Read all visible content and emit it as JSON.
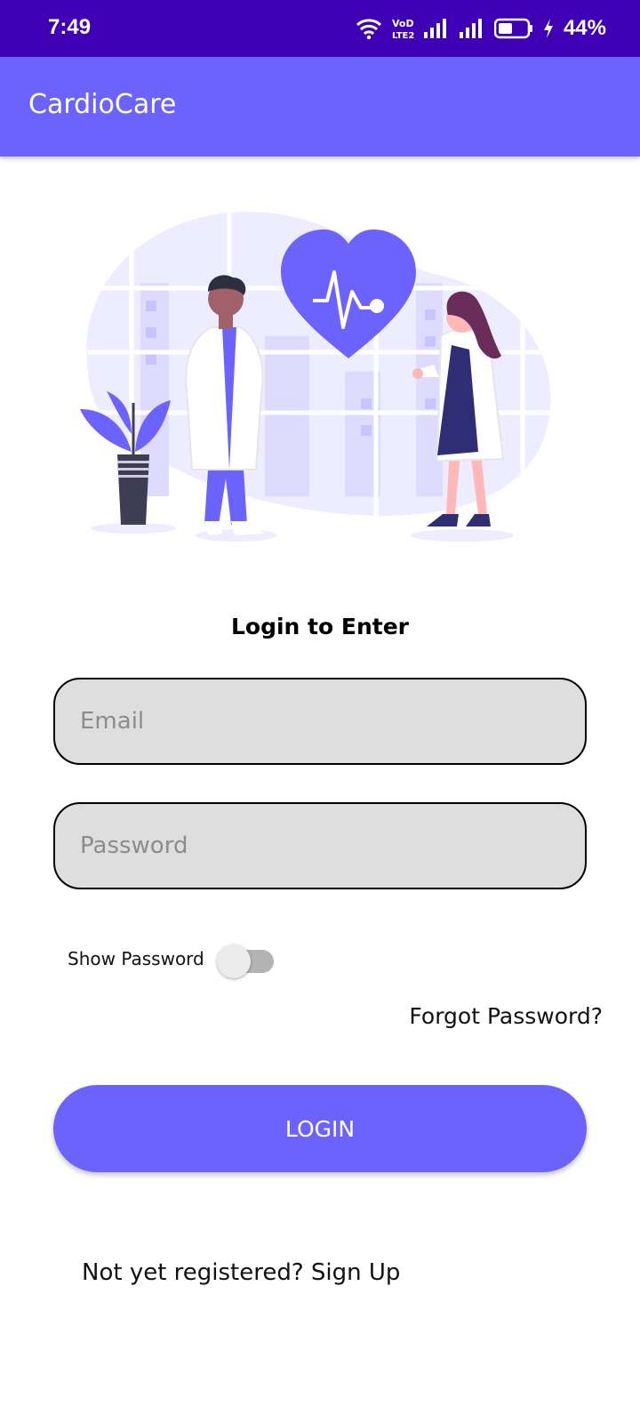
{
  "status_bar": {
    "time": "7:49",
    "network_label": "VoLTE2",
    "battery_percent": "44%",
    "icons": [
      "wifi-icon",
      "volte-icon",
      "signal-icon",
      "signal-icon",
      "battery-icon",
      "charging-icon"
    ]
  },
  "app_bar": {
    "title": "CardioCare"
  },
  "login": {
    "heading": "Login to Enter",
    "email_placeholder": "Email",
    "password_placeholder": "Password",
    "show_password_label": "Show Password",
    "show_password_on": false,
    "forgot_label": "Forgot Password?",
    "login_label": "LOGIN",
    "signup_label": "Not yet registered? Sign Up"
  },
  "colors": {
    "status_bar": "#3f00b5",
    "accent": "#6c63ff",
    "field_background": "#dedede"
  }
}
